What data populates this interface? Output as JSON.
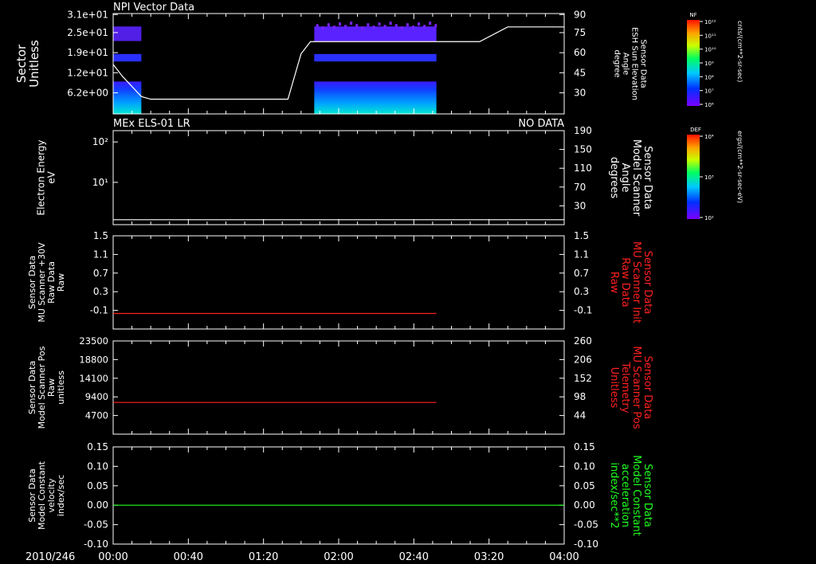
{
  "date_label": "2010/246",
  "time_ticks": [
    "00:00",
    "00:40",
    "01:20",
    "02:00",
    "02:40",
    "03:20",
    "04:00"
  ],
  "panels": [
    {
      "title_left": "NPI Vector Data",
      "title_right": "",
      "ylabel_left": [
        "Sector",
        "Unitless"
      ],
      "ylabel_right": [
        "Sensor Data",
        "ESH Sun Elevation",
        "Angle",
        "degree"
      ],
      "ylabel_right_color": "#ffffff",
      "left_ticks": [
        "3.1e+01",
        "2.5e+01",
        "1.9e+01",
        "1.2e+01",
        "6.2e+00"
      ],
      "right_ticks": [
        "90",
        "75",
        "60",
        "45",
        "30"
      ],
      "colorbar": {
        "label": "NF",
        "ticks": [
          "10¹²",
          "10¹¹",
          "10¹⁰",
          "10⁹",
          "10⁸",
          "10⁷",
          "10⁶"
        ],
        "unit": "cnts/(cm**2-sr-sec)"
      }
    },
    {
      "title_left": "MEx ELS-01 LR",
      "title_right": "NO DATA",
      "ylabel_left": [
        "Electron Energy",
        "eV"
      ],
      "ylabel_right": [
        "Sensor Data",
        "Model Scanner",
        "Angle",
        "degrees"
      ],
      "ylabel_right_color": "#ffffff",
      "left_ticks": [
        "10²",
        "10¹"
      ],
      "right_ticks": [
        "190",
        "150",
        "110",
        "70",
        "30"
      ],
      "colorbar": {
        "label": "DEF",
        "ticks": [
          "10⁴",
          "10³",
          "10²"
        ],
        "unit": "ergs/(cm**2-sr-sec-eV)"
      }
    },
    {
      "title_left": "",
      "title_right": "",
      "ylabel_left": [
        "Sensor Data",
        "MU Scanner +30V",
        "Raw Data",
        "Raw"
      ],
      "ylabel_right": [
        "Sensor Data",
        "MU Scanner Init",
        "Raw Data",
        "Raw"
      ],
      "ylabel_right_color": "#ff2020",
      "left_ticks": [
        "1.5",
        "1.1",
        "0.7",
        "0.3",
        "-0.1"
      ],
      "right_ticks": [
        "1.5",
        "1.1",
        "0.7",
        "0.3",
        "-0.1"
      ]
    },
    {
      "title_left": "",
      "title_right": "",
      "ylabel_left": [
        "Sensor Data",
        "Model Scanner Pos",
        "Raw",
        "unitless"
      ],
      "ylabel_right": [
        "Sensor Data",
        "MU Scanner Pos",
        "Telemetry",
        "Unitless"
      ],
      "ylabel_right_color": "#ff2020",
      "left_ticks": [
        "23500",
        "18800",
        "14100",
        "9400",
        "4700"
      ],
      "right_ticks": [
        "260",
        "206",
        "152",
        "98",
        "44"
      ]
    },
    {
      "title_left": "",
      "title_right": "",
      "ylabel_left": [
        "Sensor Data",
        "Model Constant",
        "velocity",
        "index/sec"
      ],
      "ylabel_right": [
        "Sensor Data",
        "Model Constant",
        "acceleration",
        "index/sec**2"
      ],
      "ylabel_right_color": "#20ff20",
      "left_ticks": [
        "0.15",
        "0.10",
        "0.05",
        "0.00",
        "-0.05",
        "-0.10"
      ],
      "right_ticks": [
        "0.15",
        "0.10",
        "0.05",
        "0.00",
        "-0.05",
        "-0.10"
      ]
    }
  ],
  "chart_data": [
    {
      "type": "heatmap",
      "title": "NPI Vector Data",
      "xlabel": "",
      "ylabel": "Sector Unitless",
      "x_units": "minutes since 00:00",
      "xlim": [
        0,
        240
      ],
      "ylim": [
        0,
        31
      ],
      "data_intervals": [
        [
          0,
          15
        ],
        [
          107,
          172
        ]
      ],
      "overlay_line": {
        "name": "ESH Sun Elevation Angle",
        "ylim_right": [
          15,
          90
        ],
        "x": [
          0,
          5,
          15,
          20,
          93,
          100,
          105,
          172,
          195,
          210,
          240
        ],
        "y": [
          52,
          43,
          28,
          26,
          26,
          60,
          69,
          69,
          69,
          80,
          80
        ]
      }
    },
    {
      "type": "heatmap",
      "title": "MEx ELS-01 LR",
      "note": "NO DATA",
      "ylabel": "Electron Energy eV",
      "overlay_line": {
        "name": "Model Scanner Angle",
        "ylim_right": [
          0,
          190
        ],
        "x": [
          0,
          240
        ],
        "y": [
          10,
          10
        ]
      }
    },
    {
      "type": "line",
      "ylabel": "MU Scanner +30V Raw Data",
      "ylim": [
        -0.3,
        1.5
      ],
      "series": [
        {
          "color": "#ff2020",
          "x": [
            0,
            172
          ],
          "y": [
            0.0,
            0.0
          ]
        }
      ]
    },
    {
      "type": "line",
      "ylabel": "Model Scanner Pos Raw",
      "ylim": [
        0,
        23500
      ],
      "series": [
        {
          "color": "#ff2020",
          "x": [
            0,
            172
          ],
          "y": [
            8000,
            8000
          ]
        }
      ]
    },
    {
      "type": "line",
      "ylabel": "Model Constant velocity index/sec",
      "ylim": [
        -0.1,
        0.15
      ],
      "series": [
        {
          "color": "#20ff20",
          "x": [
            0,
            240
          ],
          "y": [
            0.0,
            0.0
          ]
        }
      ]
    }
  ]
}
